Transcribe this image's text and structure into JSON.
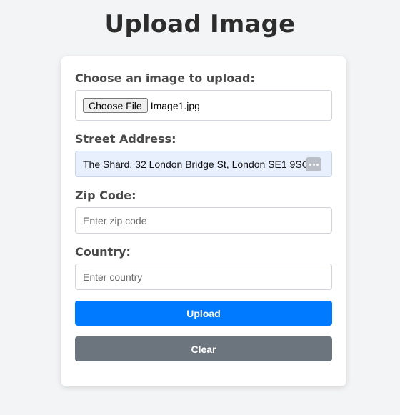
{
  "page": {
    "title": "Upload Image"
  },
  "form": {
    "file": {
      "label": "Choose an image to upload:",
      "button_label": "Choose File",
      "file_name": "Image1.jpg"
    },
    "street": {
      "label": "Street Address:",
      "value": "The Shard, 32 London Bridge St, London SE1 9SG"
    },
    "zip": {
      "label": "Zip Code:",
      "placeholder": "Enter zip code",
      "value": ""
    },
    "country": {
      "label": "Country:",
      "placeholder": "Enter country",
      "value": ""
    },
    "upload_label": "Upload",
    "clear_label": "Clear"
  },
  "colors": {
    "upload_button": "#007bff",
    "clear_button": "#6c757d",
    "autofill_background": "#e8f0fe"
  },
  "icons": {
    "autofill": "more-horizontal-icon"
  }
}
